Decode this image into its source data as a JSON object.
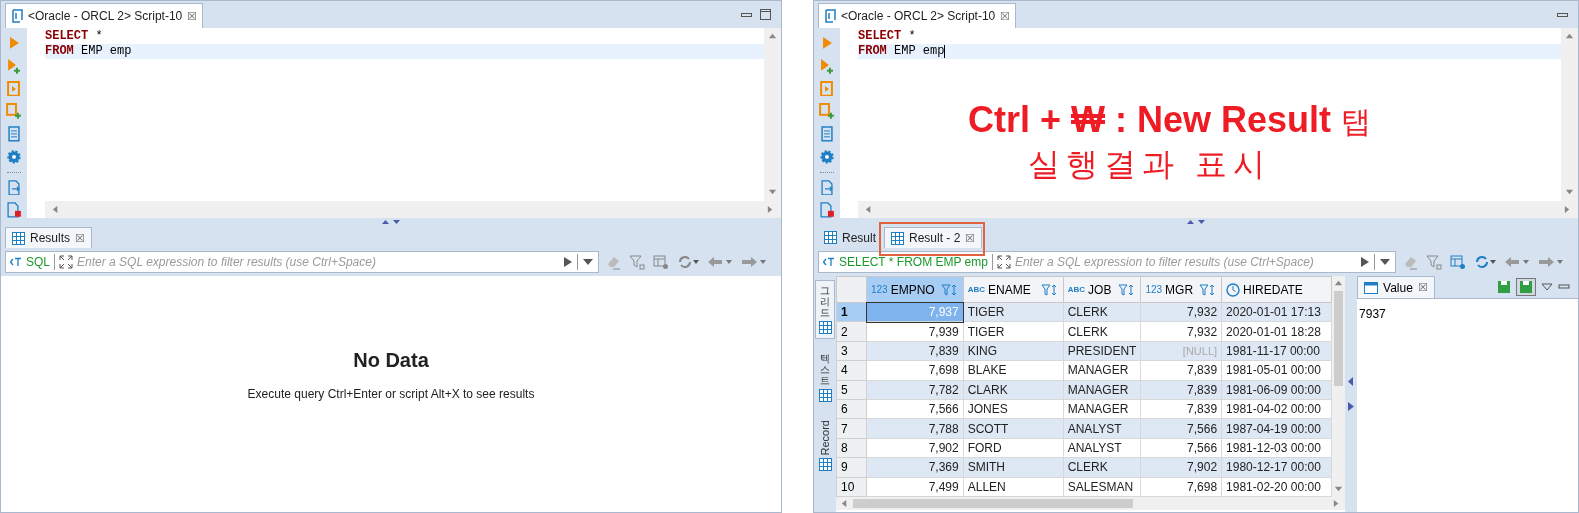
{
  "panels": [
    {
      "editor_tab": {
        "title": "<Oracle - ORCL 2> Script-10",
        "close": "☒"
      },
      "window_buttons": [
        {
          "kind": "minimize"
        },
        {
          "kind": "maximize"
        }
      ],
      "sql_lines": [
        {
          "keyword": "SELECT",
          "rest": " *",
          "current": false
        },
        {
          "keyword": "FROM",
          "rest": " EMP emp",
          "current": true
        }
      ],
      "cursor": false,
      "result_tabs": [
        {
          "label": "Results",
          "selected": true,
          "close": "☒"
        }
      ],
      "filter": {
        "prefix": "SQL",
        "placeholder": "Enter a SQL expression to filter results (use Ctrl+Space)"
      },
      "content": {
        "kind": "empty",
        "title": "No Data",
        "message": "Execute query Ctrl+Enter or script Alt+X to see results"
      }
    },
    {
      "editor_tab": {
        "title": "<Oracle - ORCL 2> Script-10",
        "close": "☒"
      },
      "window_buttons": [
        {
          "kind": "minimize"
        }
      ],
      "sql_lines": [
        {
          "keyword": "SELECT",
          "rest": " *",
          "current": false
        },
        {
          "keyword": "FROM",
          "rest": " EMP emp",
          "current": true
        }
      ],
      "cursor": true,
      "annotation": {
        "line_1": "Ctrl + ₩ : New Result",
        "line_1_suffix": "탭",
        "line_2": "실행결과 표시"
      },
      "result_tabs": [
        {
          "label": "Result",
          "selected": false
        },
        {
          "label": "Result - 2",
          "selected": true,
          "close": "☒",
          "highlighted": true
        }
      ],
      "filter": {
        "prefix": "SELECT * FROM EMP emp",
        "placeholder": "Enter a SQL expression to filter results (use Ctrl+Space)"
      },
      "content": {
        "kind": "grid",
        "side_tabs": [
          {
            "label": "그리드",
            "selected": true,
            "kind": "stacked"
          },
          {
            "label": "텍스트",
            "selected": false,
            "kind": "stacked"
          },
          {
            "label": "Record",
            "selected": false,
            "kind": "rotated"
          }
        ],
        "columns": [
          {
            "name": "EMPNO",
            "type_label": "123",
            "kind": "number",
            "selected": true
          },
          {
            "name": "ENAME",
            "type_label": "ABC",
            "kind": "string",
            "selected": false
          },
          {
            "name": "JOB",
            "type_label": "ABC",
            "kind": "string",
            "selected": false
          },
          {
            "name": "MGR",
            "type_label": "123",
            "kind": "number",
            "selected": false
          },
          {
            "name": "HIREDATE",
            "kind": "date",
            "selected": false
          }
        ],
        "rows": [
          {
            "num": "1",
            "empno": "7,937",
            "ename": "TIGER",
            "job": "CLERK",
            "mgr": "7,932",
            "mgr_null": false,
            "hiredate": "2020-01-01 17:13",
            "selected": true
          },
          {
            "num": "2",
            "empno": "7,939",
            "ename": "TIGER",
            "job": "CLERK",
            "mgr": "7,932",
            "mgr_null": false,
            "hiredate": "2020-01-01 18:28",
            "selected": false
          },
          {
            "num": "3",
            "empno": "7,839",
            "ename": "KING",
            "job": "PRESIDENT",
            "mgr": "[NULL]",
            "mgr_null": true,
            "hiredate": "1981-11-17 00:00",
            "selected": false
          },
          {
            "num": "4",
            "empno": "7,698",
            "ename": "BLAKE",
            "job": "MANAGER",
            "mgr": "7,839",
            "mgr_null": false,
            "hiredate": "1981-05-01 00:00",
            "selected": false
          },
          {
            "num": "5",
            "empno": "7,782",
            "ename": "CLARK",
            "job": "MANAGER",
            "mgr": "7,839",
            "mgr_null": false,
            "hiredate": "1981-06-09 00:00",
            "selected": false
          },
          {
            "num": "6",
            "empno": "7,566",
            "ename": "JONES",
            "job": "MANAGER",
            "mgr": "7,839",
            "mgr_null": false,
            "hiredate": "1981-04-02 00:00",
            "selected": false
          },
          {
            "num": "7",
            "empno": "7,788",
            "ename": "SCOTT",
            "job": "ANALYST",
            "mgr": "7,566",
            "mgr_null": false,
            "hiredate": "1987-04-19 00:00",
            "selected": false
          },
          {
            "num": "8",
            "empno": "7,902",
            "ename": "FORD",
            "job": "ANALYST",
            "mgr": "7,566",
            "mgr_null": false,
            "hiredate": "1981-12-03 00:00",
            "selected": false
          },
          {
            "num": "9",
            "empno": "7,369",
            "ename": "SMITH",
            "job": "CLERK",
            "mgr": "7,902",
            "mgr_null": false,
            "hiredate": "1980-12-17 00:00",
            "selected": false
          },
          {
            "num": "10",
            "empno": "7,499",
            "ename": "ALLEN",
            "job": "SALESMAN",
            "mgr": "7,698",
            "mgr_null": false,
            "hiredate": "1981-02-20 00:00",
            "selected": false
          }
        ],
        "value_panel": {
          "title": "Value",
          "close": "☒",
          "value": "7937"
        }
      }
    }
  ]
}
